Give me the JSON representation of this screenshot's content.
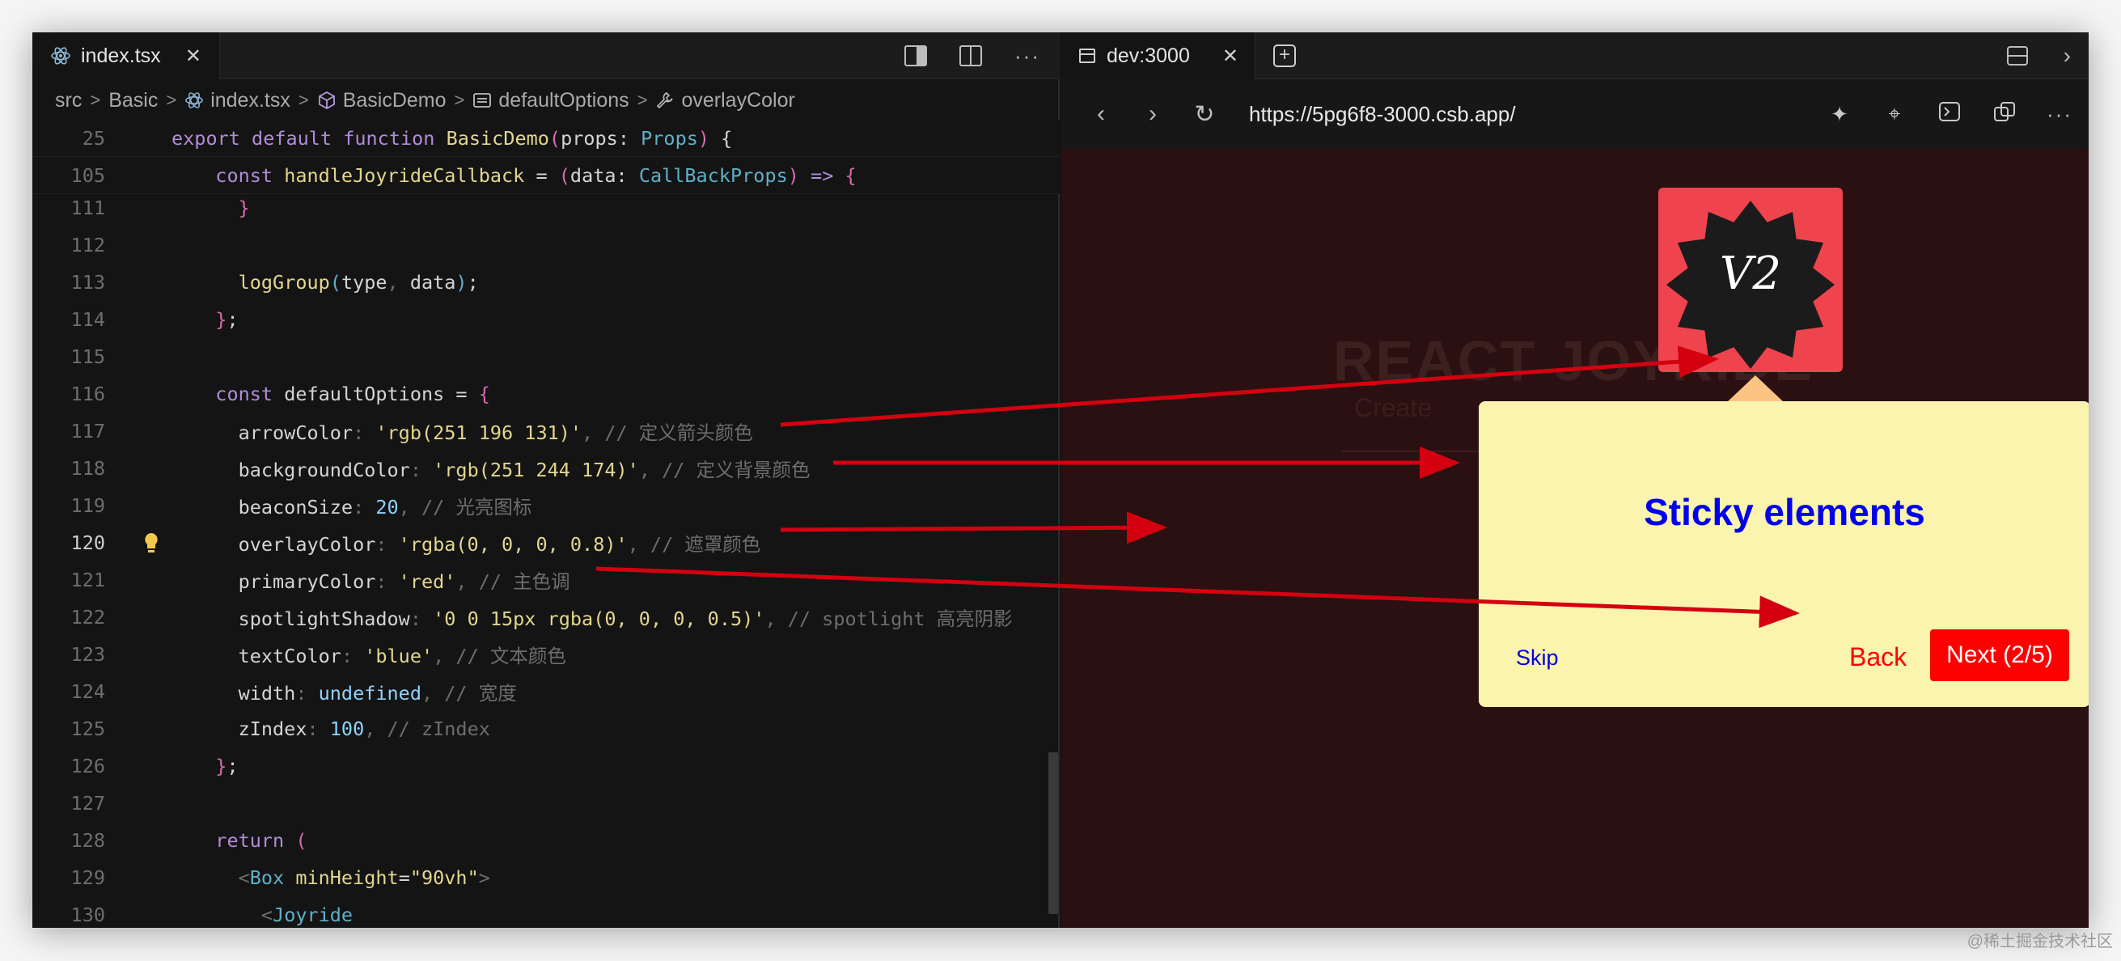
{
  "editor": {
    "tab_label": "index.tsx",
    "breadcrumb": [
      "src",
      "Basic",
      "index.tsx",
      "BasicDemo",
      "defaultOptions",
      "overlayColor"
    ],
    "sticky_lines": [
      {
        "n": "25",
        "parts": [
          [
            "kw",
            "export "
          ],
          [
            "kw",
            "default "
          ],
          [
            "kw",
            "function "
          ],
          [
            "fn",
            "BasicDemo"
          ],
          [
            "pink",
            "("
          ],
          [
            "pr",
            "props"
          ],
          [
            "pr",
            ": "
          ],
          [
            "ty",
            "Props"
          ],
          [
            "pink",
            ")"
          ],
          [
            "pr",
            " {"
          ]
        ]
      },
      {
        "n": "105",
        "parts": [
          [
            "pr",
            "  "
          ],
          [
            "kw",
            "const "
          ],
          [
            "fn",
            "handleJoyrideCallback"
          ],
          [
            "pr",
            " = "
          ],
          [
            "pink",
            "("
          ],
          [
            "pr",
            "data"
          ],
          [
            "pr",
            ": "
          ],
          [
            "ty",
            "CallBackProps"
          ],
          [
            "pink",
            ")"
          ],
          [
            "kw",
            " => "
          ],
          [
            "pink",
            "{"
          ]
        ]
      }
    ],
    "lines": [
      {
        "n": "111",
        "parts": [
          [
            "pr",
            "    "
          ],
          [
            "pink",
            "}"
          ]
        ]
      },
      {
        "n": "112",
        "parts": []
      },
      {
        "n": "113",
        "parts": [
          [
            "pr",
            "    "
          ],
          [
            "fn",
            "logGroup"
          ],
          [
            "ty",
            "("
          ],
          [
            "pr",
            "type"
          ],
          [
            "cm",
            ", "
          ],
          [
            "pr",
            "data"
          ],
          [
            "ty",
            ")"
          ],
          [
            "pr",
            ";"
          ]
        ]
      },
      {
        "n": "114",
        "parts": [
          [
            "pr",
            "  "
          ],
          [
            "pink",
            "}"
          ],
          [
            "pr",
            ";"
          ]
        ]
      },
      {
        "n": "115",
        "parts": []
      },
      {
        "n": "116",
        "parts": [
          [
            "pr",
            "  "
          ],
          [
            "kw",
            "const "
          ],
          [
            "pr",
            "defaultOptions"
          ],
          [
            "pr",
            " = "
          ],
          [
            "pink",
            "{"
          ]
        ]
      },
      {
        "n": "117",
        "parts": [
          [
            "pr",
            "    arrowColor"
          ],
          [
            "cm",
            ": "
          ],
          [
            "str",
            "'rgb(251 196 131)'"
          ],
          [
            "cm",
            ", // 定义箭头颜色"
          ]
        ]
      },
      {
        "n": "118",
        "parts": [
          [
            "pr",
            "    backgroundColor"
          ],
          [
            "cm",
            ": "
          ],
          [
            "str",
            "'rgb(251 244 174)'"
          ],
          [
            "cm",
            ", // 定义背景颜色"
          ]
        ]
      },
      {
        "n": "119",
        "parts": [
          [
            "pr",
            "    beaconSize"
          ],
          [
            "cm",
            ": "
          ],
          [
            "num",
            "20"
          ],
          [
            "cm",
            ", // 光亮图标"
          ]
        ]
      },
      {
        "n": "120",
        "parts": [
          [
            "pr",
            "    overlayColor"
          ],
          [
            "cm",
            ": "
          ],
          [
            "str",
            "'rgba(0, 0, 0, 0.8)'"
          ],
          [
            "cm",
            ", // 遮罩颜色"
          ]
        ]
      },
      {
        "n": "121",
        "parts": [
          [
            "pr",
            "    primaryColor"
          ],
          [
            "cm",
            ": "
          ],
          [
            "str",
            "'red'"
          ],
          [
            "cm",
            ", // 主色调"
          ]
        ]
      },
      {
        "n": "122",
        "parts": [
          [
            "pr",
            "    spotlightShadow"
          ],
          [
            "cm",
            ": "
          ],
          [
            "str",
            "'0 0 15px rgba(0, 0, 0, 0.5)'"
          ],
          [
            "cm",
            ", // spotlight 高亮阴影"
          ]
        ]
      },
      {
        "n": "123",
        "parts": [
          [
            "pr",
            "    textColor"
          ],
          [
            "cm",
            ": "
          ],
          [
            "str",
            "'blue'"
          ],
          [
            "cm",
            ", // 文本颜色"
          ]
        ]
      },
      {
        "n": "124",
        "parts": [
          [
            "pr",
            "    width"
          ],
          [
            "cm",
            ": "
          ],
          [
            "num",
            "undefined"
          ],
          [
            "cm",
            ", // 宽度"
          ]
        ]
      },
      {
        "n": "125",
        "parts": [
          [
            "pr",
            "    zIndex"
          ],
          [
            "cm",
            ": "
          ],
          [
            "num",
            "100"
          ],
          [
            "cm",
            ", // zIndex"
          ]
        ]
      },
      {
        "n": "126",
        "parts": [
          [
            "pr",
            "  "
          ],
          [
            "pink",
            "}"
          ],
          [
            "pr",
            ";"
          ]
        ]
      },
      {
        "n": "127",
        "parts": []
      },
      {
        "n": "128",
        "parts": [
          [
            "pr",
            "  "
          ],
          [
            "kw",
            "return "
          ],
          [
            "pink",
            "("
          ]
        ]
      },
      {
        "n": "129",
        "parts": [
          [
            "pr",
            "    "
          ],
          [
            "cm",
            "<"
          ],
          [
            "ty",
            "Box "
          ],
          [
            "fn",
            "minHeight"
          ],
          [
            "pr",
            "="
          ],
          [
            "str",
            "\"90vh\""
          ],
          [
            "cm",
            ">"
          ]
        ]
      },
      {
        "n": "130",
        "parts": [
          [
            "pr",
            "      "
          ],
          [
            "cm",
            "<"
          ],
          [
            "ty",
            "Joyride"
          ]
        ]
      }
    ],
    "active_line": "120"
  },
  "browser": {
    "tab_label": "dev:3000",
    "url": "https://5pg6f8-3000.csb.app/",
    "hero_title": "REACT JOYRIDE",
    "hero_subtitle": "Create",
    "logo_text": "V2",
    "tooltip": {
      "title": "Sticky elements",
      "skip": "Skip",
      "back": "Back",
      "next": "Next (2/5)"
    }
  },
  "colors": {
    "overlay": "#2a1010",
    "tooltip_bg": "#fbf4ae",
    "arrow": "#fbc483",
    "primary": "#ff0000",
    "text": "#0000ee",
    "annotation_arrow": "#d40010"
  },
  "icons": [
    "react-icon",
    "close-icon",
    "split-editor-icon",
    "layout-icon",
    "more-icon",
    "cube-icon",
    "property-icon",
    "wrench-icon",
    "page-icon",
    "new-tab-icon",
    "back-icon",
    "forward-icon",
    "reload-icon",
    "sparkle-icon",
    "crosshair-icon",
    "terminal-icon",
    "copy-icon",
    "lightbulb-icon"
  ],
  "watermark": "@稀土掘金技术社区"
}
